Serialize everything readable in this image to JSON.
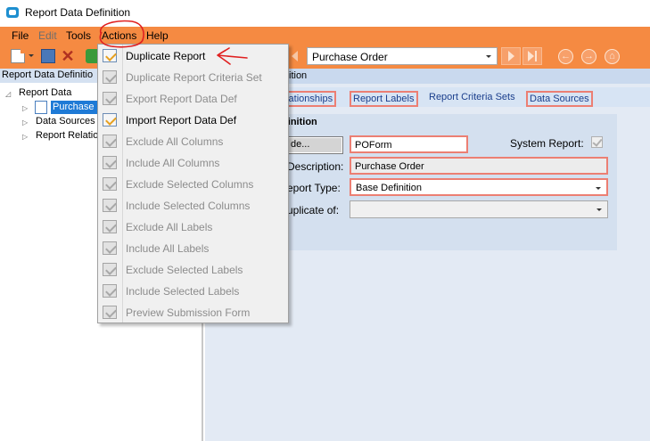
{
  "window": {
    "title": "Report Data Definition",
    "icon": "app-icon"
  },
  "menubar": {
    "items": [
      "File",
      "Edit",
      "Tools",
      "Actions",
      "Help"
    ],
    "disabled": [
      "Edit"
    ],
    "active": "Actions"
  },
  "toolbar": {
    "icons": [
      "new-document-icon",
      "dropdown-arrow-icon",
      "save-icon",
      "delete-icon",
      "refresh-icon"
    ],
    "record_selector": "Purchase Order",
    "nav_icons": [
      "prev-record-icon",
      "next-record-icon",
      "last-record-icon",
      "back-icon",
      "forward-icon",
      "home-icon"
    ]
  },
  "left_panel": {
    "header": "Report Data Definitio",
    "tree": {
      "root": "Report Data",
      "children": [
        {
          "label": "Purchase",
          "selected": true
        },
        {
          "label": "Data Sources"
        },
        {
          "label": "Report Relatio"
        }
      ]
    }
  },
  "right_panel": {
    "header": "ition",
    "tabs": [
      "elationships",
      "Report Labels",
      "Report Criteria Sets",
      "Data Sources"
    ],
    "highlighted_tabs": [
      "elationships",
      "Report Labels",
      "Data Sources"
    ],
    "group_title": "efinition",
    "fields": {
      "code_button": "de...",
      "code_value": "POForm",
      "system_report_label": "System Report:",
      "system_report_checked": true,
      "description_label": "Description:",
      "description_value": "Purchase Order",
      "report_type_label": "eport Type:",
      "report_type_value": "Base Definition",
      "duplicate_of_label": "uplicate of:",
      "duplicate_of_value": ""
    }
  },
  "actions_menu": {
    "items": [
      {
        "label": "Duplicate Report",
        "enabled": true
      },
      {
        "label": "Duplicate Report Criteria Set",
        "enabled": false
      },
      {
        "label": "Export Report Data Def",
        "enabled": false
      },
      {
        "label": "Import Report Data Def",
        "enabled": true
      },
      {
        "label": "Exclude All Columns",
        "enabled": false
      },
      {
        "label": "Include All Columns",
        "enabled": false
      },
      {
        "label": "Exclude Selected Columns",
        "enabled": false
      },
      {
        "label": "Include Selected Columns",
        "enabled": false
      },
      {
        "label": "Exclude All Labels",
        "enabled": false
      },
      {
        "label": "Include All Labels",
        "enabled": false
      },
      {
        "label": "Exclude Selected Labels",
        "enabled": false
      },
      {
        "label": "Include Selected Labels",
        "enabled": false
      },
      {
        "label": "Preview Submission Form",
        "enabled": false
      }
    ]
  },
  "colors": {
    "orange_bar": "#f58a42",
    "highlight_red": "#ec7f73",
    "annotation_red": "#e02020",
    "tab_link": "#1a3e8c",
    "selection_blue": "#1e7ad6"
  }
}
